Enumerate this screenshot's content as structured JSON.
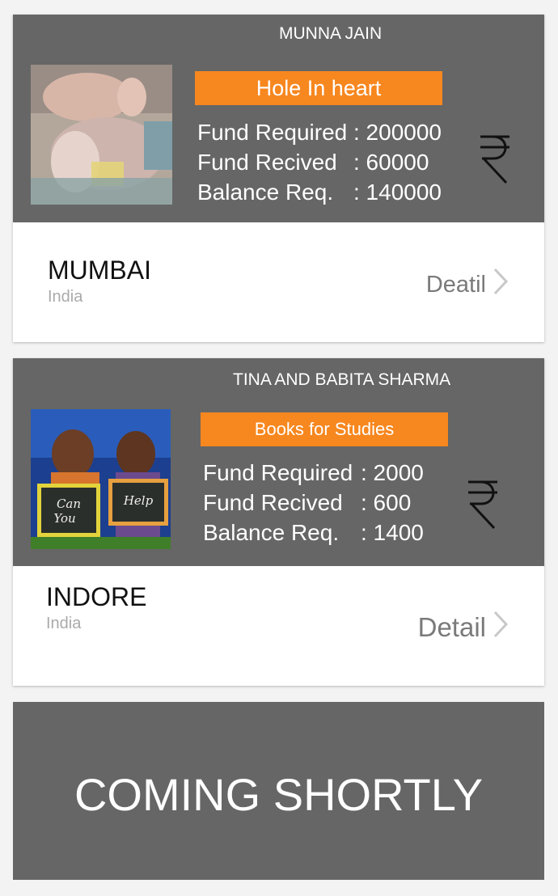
{
  "cards": [
    {
      "name": "MUNNA JAIN",
      "cause": "Hole In heart",
      "fund_required_label": "Fund Required",
      "fund_required_value": ": 200000",
      "fund_received_label": "Fund Recived",
      "fund_received_value": ": 60000",
      "balance_label": "Balance Req.",
      "balance_value": ": 140000",
      "currency_symbol": "₹",
      "city": "MUMBAI",
      "country": "India",
      "detail_label": "Deatil"
    },
    {
      "name": "TINA AND BABITA SHARMA",
      "cause": "Books for Studies",
      "fund_required_label": "Fund Required",
      "fund_required_value": ": 2000",
      "fund_received_label": "Fund Recived",
      "fund_received_value": ": 600",
      "balance_label": "Balance Req.",
      "balance_value": ": 1400",
      "currency_symbol": "₹",
      "city": "INDORE",
      "country": "India",
      "detail_label": "Detail",
      "photo_sign_left": "Can You",
      "photo_sign_right": "Help"
    }
  ],
  "coming_text": "COMING SHORTLY",
  "colors": {
    "card_header_bg": "#666666",
    "cause_badge_bg": "#f7871f",
    "page_bg": "#f3f3f3"
  }
}
